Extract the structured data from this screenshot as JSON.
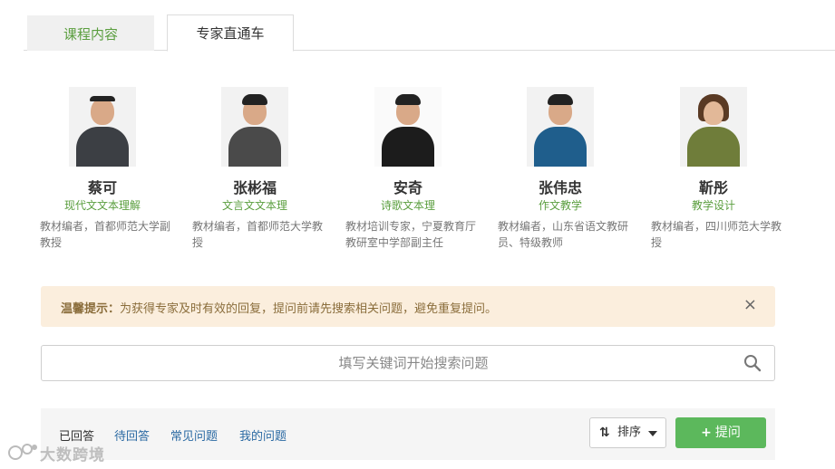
{
  "tabs": [
    {
      "label": "课程内容"
    },
    {
      "label": "专家直通车"
    }
  ],
  "experts": [
    {
      "name": "蔡可",
      "field": "现代文文本理解",
      "desc": "教材编者，首都师范大学副教授",
      "body_color": "#3c3f44"
    },
    {
      "name": "张彬福",
      "field": "文言文文本理",
      "desc": "教材编者，首都师范大学教授",
      "body_color": "#4a4a4a"
    },
    {
      "name": "安奇",
      "field": "诗歌文本理",
      "desc": "教材培训专家，宁夏教育厅教研室中学部副主任",
      "body_color": "#1c1c1c"
    },
    {
      "name": "张伟忠",
      "field": "作文教学",
      "desc": "教材编者，山东省语文教研员、特级教师",
      "body_color": "#1f5e8c"
    },
    {
      "name": "靳彤",
      "field": "教学设计",
      "desc": "教材编者，四川师范大学教授",
      "body_color": "#6f7d3a"
    }
  ],
  "notice": {
    "title": "温馨提示：",
    "text": "为获得专家及时有效的回复，提问前请先搜索相关问题，避免重复提问。",
    "close": "×"
  },
  "search": {
    "placeholder": "填写关键词开始搜索问题",
    "icon": "search-icon"
  },
  "filters": [
    {
      "label": "已回答"
    },
    {
      "label": "待回答"
    },
    {
      "label": "常见问题"
    },
    {
      "label": "我的问题"
    }
  ],
  "sort": {
    "label": "排序",
    "icon": "sort-arrows-icon"
  },
  "ask": {
    "label": "提问",
    "icon": "plus-icon"
  },
  "watermark": {
    "text": "大数跨境"
  },
  "colors": {
    "accent_green": "#5a9e3e",
    "button_green": "#5cb85c",
    "link_blue": "#2b6aa3",
    "notice_bg": "#fbeedd"
  }
}
